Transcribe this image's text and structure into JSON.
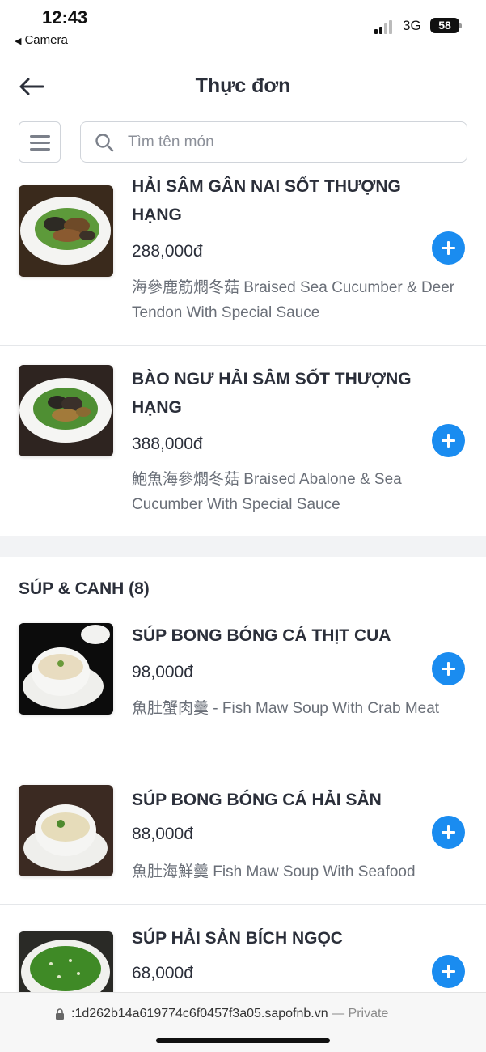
{
  "status_bar": {
    "time": "12:43",
    "back_app": "Camera",
    "network": "3G",
    "battery": "58"
  },
  "header": {
    "title": "Thực đơn"
  },
  "search": {
    "placeholder": "Tìm tên món"
  },
  "items_top": [
    {
      "name": "HẢI SÂM GÂN NAI SỐT THƯỢNG HẠNG",
      "price": "288,000đ",
      "description": "海參鹿筋燜冬菇 Braised Sea Cucumber & Deer Tendon With Special Sauce",
      "image": "sea-cucumber-deer-tendon-dish"
    },
    {
      "name": "BÀO NGƯ HẢI SÂM SỐT THƯỢNG HẠNG",
      "price": "388,000đ",
      "description": "鮑魚海參燜冬菇 Braised Abalone & Sea Cucumber With Special Sauce",
      "image": "abalone-sea-cucumber-dish"
    }
  ],
  "section": {
    "title": "SÚP & CANH (8)"
  },
  "items_soup": [
    {
      "name": "SÚP BONG BÓNG CÁ THỊT CUA",
      "price": "98,000đ",
      "description": "魚肚蟹肉羹 - Fish Maw Soup With Crab Meat",
      "image": "fish-maw-crab-soup"
    },
    {
      "name": "SÚP BONG BÓNG CÁ HẢI SẢN",
      "price": "88,000đ",
      "description": "魚肚海鮮羹 Fish Maw Soup With Seafood",
      "image": "fish-maw-seafood-soup"
    },
    {
      "name": "SÚP HẢI SẢN BÍCH NGỌC",
      "price": "68,000đ",
      "description": "",
      "image": "green-seafood-soup"
    }
  ],
  "url_bar": {
    "url": ":1d262b14a619774c6f0457f3a05.sapofnb.vn",
    "suffix": "— Private"
  },
  "colors": {
    "accent": "#1a8cf0",
    "text": "#2b2f3a",
    "muted": "#6a6f78"
  }
}
